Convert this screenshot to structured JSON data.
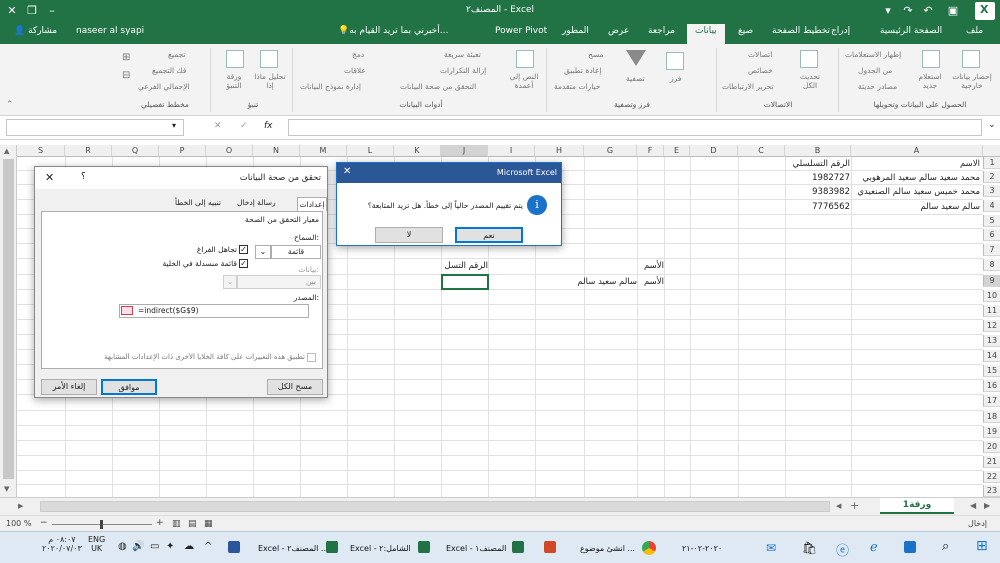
{
  "window": {
    "title": "المصنف٢ - Excel",
    "user": "naseer al syapi",
    "share": "مشاركة",
    "tell_me": "أخبرني بما تريد القيام به...",
    "controls": [
      "–",
      "❐",
      "✕"
    ]
  },
  "tabs": [
    "ملف",
    "الصفحة الرئيسية",
    "إدراج",
    "تخطيط الصفحة",
    "صيغ",
    "بيانات",
    "مراجعة",
    "عرض",
    "المطور",
    "Power Pivot"
  ],
  "ribbon": {
    "groups": [
      "الحصول على البيانات وتحويلها",
      "الاتصالات",
      "فرز وتصفية",
      "أدوات البيانات",
      "تنبؤ",
      "مخطط تفصيلي"
    ],
    "get": {
      "big1": "إحضار بيانات خارجية",
      "big2": "استعلام جديد",
      "small": [
        "إظهار الاستعلامات",
        "من الجدول",
        "مصادر حديثة"
      ]
    },
    "conn": {
      "big": "تحديث الكل",
      "small": [
        "اتصالات",
        "خصائص",
        "تحرير الارتباطات"
      ]
    },
    "sort": {
      "big1": "فرز",
      "big2": "تصفية",
      "small": [
        "مسح",
        "إعادة تطبيق",
        "خيارات متقدمة"
      ]
    },
    "tools": {
      "big": "النص إلى أعمدة",
      "small": [
        "تعبئة سريعة",
        "إزالة التكرارات",
        "التحقق من صحة البيانات",
        "دمج",
        "علاقات",
        "إدارة نموذج البيانات"
      ]
    },
    "forecast": {
      "big1": "تحليل ماذا إذا",
      "big2": "ورقة التنبؤ"
    },
    "outline": {
      "small": [
        "تجميع",
        "فك التجميع",
        "الإجمالي الفرعي"
      ]
    }
  },
  "formula_bar": {
    "fx": "fx",
    "cancel": "✕",
    "enter": "✓"
  },
  "columns": [
    "A",
    "B",
    "C",
    "D",
    "E",
    "F",
    "G",
    "H",
    "I",
    "J",
    "K",
    "L",
    "M",
    "N",
    "O",
    "P",
    "Q",
    "R",
    "S"
  ],
  "rows": [
    "1",
    "2",
    "3",
    "4",
    "5",
    "6",
    "7",
    "8",
    "9",
    "10",
    "11",
    "12",
    "13",
    "14",
    "15",
    "16",
    "17",
    "18",
    "19",
    "20",
    "21",
    "22",
    "23"
  ],
  "cells": {
    "A1": "الاسم",
    "B1": "الرقم التسلسلي",
    "A2": "محمد سعيد سالم سعيد المرهوبي",
    "B2": "1982727",
    "A3": "محمد خميس سعيد سالم الصنعيدي",
    "B3": "9383982",
    "A4": "سالم سعيد سالم",
    "B4": "7776562",
    "F8": "الأسم",
    "J8": "الرقم التسل",
    "F9": "الأسم",
    "G9": "سالم سعيد سالم"
  },
  "sheet_tab": "ورقة1",
  "add_sheet": "+",
  "status": {
    "mode": "إدخال",
    "zoom": "100 %"
  },
  "msgbox": {
    "title": "Microsoft Excel",
    "message": "يتم تقييم المصدر حالياً إلى خطأ. هل تريد المتابعة؟",
    "info": "i",
    "yes": "نعم",
    "no": "لا"
  },
  "validation": {
    "title": "تحقق من صحة البيانات",
    "help": "؟",
    "tabs": [
      "إعدادات",
      "رسالة إدخال",
      "تنبيه إلى الخطأ"
    ],
    "section": "معيار التحقق من الصحة",
    "allow_label": "السماح:",
    "allow_value": "قائمة",
    "ignore_blank": "تجاهل الفراغ",
    "incell": "قائمة منسدلة في الخلية",
    "data_label": "بيانات:",
    "data_value": "بين",
    "source_label": "المصدر:",
    "source_value": "=indirect($G$9)",
    "apply_all": "تطبيق هذه التغييرات على كافة الخلايا الأخرى ذات الإعدادات المشابهة",
    "clear": "مسح الكل",
    "ok": "موافق",
    "cancel": "إلغاء الأمر"
  },
  "taskbar": {
    "time": "٠٨:٠٧ م",
    "date": "٢٠٢٠/٠٧/٠٣",
    "lang": "ENG",
    "region": "UK",
    "apps": [
      "Excel - المصنف٢ ...",
      "Excel - الشامل:٢",
      "Excel - المصنف١",
      "انشئ موضوع ...",
      "٢٠٢٠-٠٢-٢١"
    ]
  },
  "colors": {
    "excel": "#217346",
    "accent": "#1a73c8"
  }
}
